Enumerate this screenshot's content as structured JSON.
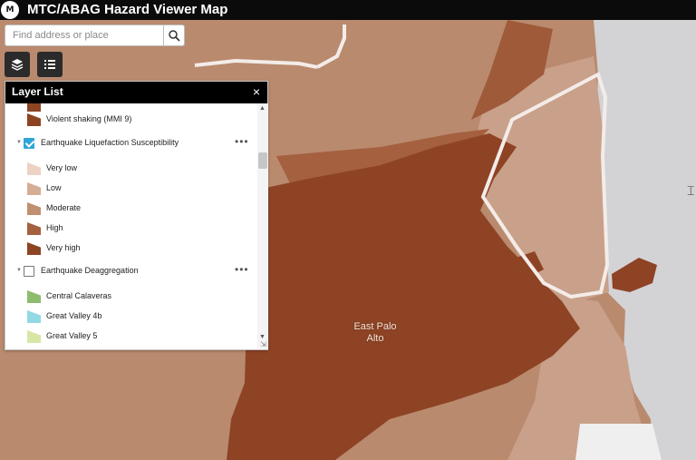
{
  "app": {
    "logo_text": "M",
    "title": "MTC/ABAG Hazard Viewer Map"
  },
  "search": {
    "placeholder": "Find address or place",
    "value": ""
  },
  "toolbar": {
    "layers_icon": "layers-icon",
    "legend_icon": "list-icon"
  },
  "panel": {
    "title": "Layer List",
    "close": "×",
    "cut_off_item": "Violent shaking (MMI 9)",
    "layers": [
      {
        "name": "Earthquake Liquefaction Susceptibility",
        "checked": true,
        "legend": [
          {
            "label": "Very low",
            "color": "#ecd3c4"
          },
          {
            "label": "Low",
            "color": "#d6ae96"
          },
          {
            "label": "Moderate",
            "color": "#c18f71"
          },
          {
            "label": "High",
            "color": "#a4603f"
          },
          {
            "label": "Very high",
            "color": "#8c4423"
          }
        ]
      },
      {
        "name": "Earthquake Deaggregation",
        "checked": false,
        "legend": [
          {
            "label": "Central Calaveras",
            "color": "#8dbc6e"
          },
          {
            "label": "Great Valley 4b",
            "color": "#93d9e4"
          },
          {
            "label": "Great Valley 5",
            "color": "#d7e6a5"
          }
        ]
      }
    ],
    "more_glyph": "•••"
  },
  "map": {
    "place_label": "East Palo Alto",
    "colors": {
      "moderate": "#b98a6e",
      "very_high": "#8e4325",
      "high": "#9f5a3a",
      "low": "#c9a08a",
      "water": "#d3d3d6",
      "road": "#f3ece8"
    }
  }
}
